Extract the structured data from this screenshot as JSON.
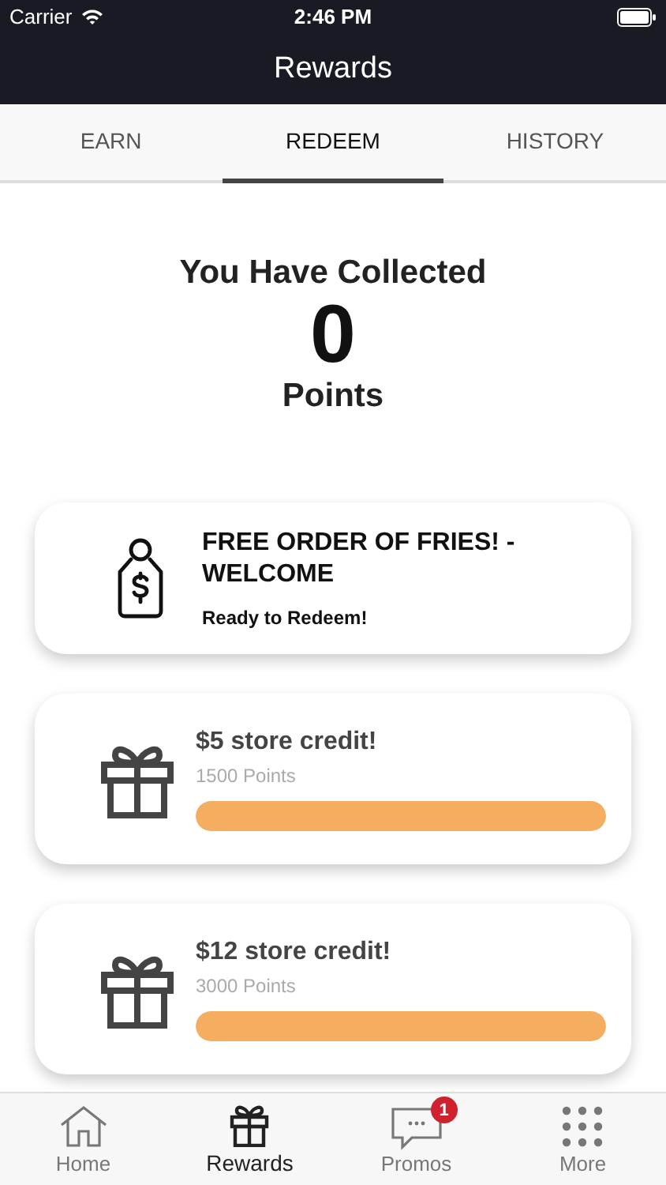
{
  "status_bar": {
    "carrier": "Carrier",
    "time": "2:46 PM"
  },
  "title": "Rewards",
  "tabs": [
    {
      "label": "EARN",
      "selected": false
    },
    {
      "label": "REDEEM",
      "selected": true
    },
    {
      "label": "HISTORY",
      "selected": false
    }
  ],
  "summary": {
    "heading": "You Have Collected",
    "points": "0",
    "unit": "Points"
  },
  "rewards": [
    {
      "kind": "ready",
      "title": "FREE ORDER OF FRIES! - WELCOME",
      "status": "Ready to Redeem!"
    },
    {
      "kind": "progress",
      "title": "$5 store credit!",
      "points": "1500 Points",
      "level": 1
    },
    {
      "kind": "progress",
      "title": "$12 store credit!",
      "points": "3000 Points",
      "level": 1
    }
  ],
  "tab_bar": [
    {
      "kind": "home",
      "label": "Home",
      "selected": false
    },
    {
      "kind": "gift",
      "label": "Rewards",
      "selected": true
    },
    {
      "kind": "chat",
      "label": "Promos",
      "selected": false,
      "badge": "1"
    },
    {
      "kind": "grid",
      "label": "More",
      "selected": false
    }
  ]
}
